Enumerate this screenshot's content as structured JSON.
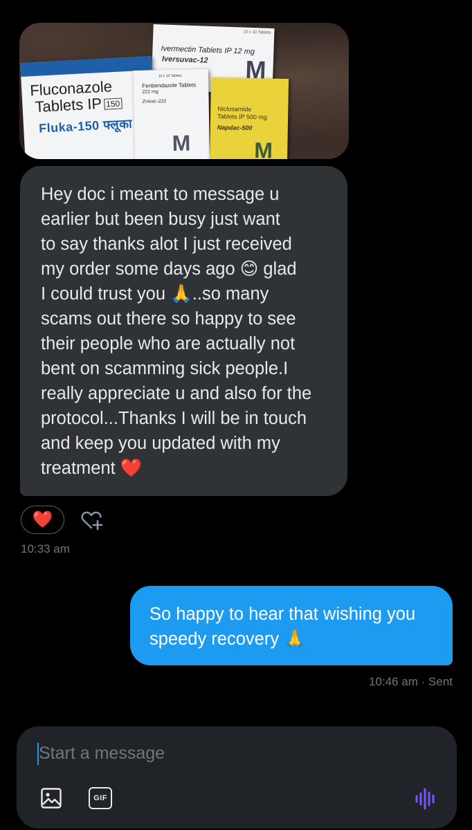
{
  "image_message": {
    "boxes": {
      "fluconazole": {
        "line1": "Fluconazole",
        "line2": "Tablets IP",
        "strength": "150",
        "brand": "Fluka-150 फ्लूका"
      },
      "ivermectin": {
        "top": "10 x 10 Tablets",
        "line1": "Ivermectin Tablets IP 12 mg",
        "brand": "Iversuvac-12",
        "mark": "M"
      },
      "fenbendazole": {
        "top": "10 x 10 Tablets",
        "line1": "Fenbendazole Tablets",
        "line2": "222 mg",
        "brand": "Zolvac-222",
        "mark": "M"
      },
      "niclosamide": {
        "line1": "Niclosamide",
        "line2": "Tablets IP 500 mg",
        "brand": "Napdac-500",
        "mark": "M"
      }
    }
  },
  "received_message": {
    "text": "Hey doc i meant to message u\nearlier but been busy just want\nto say thanks alot I just received\nmy order  some days ago 😊 glad\nI could trust you 🙏..so many\nscams out there so happy to see\ntheir people who are actually not\nbent on scamming sick people.I\nreally appreciate u and also for the\nprotocol...Thanks I will be in touch\nand keep you updated with my\ntreatment   ❤️",
    "reaction": "❤️",
    "time": "10:33 am"
  },
  "sent_message": {
    "text": "So happy to hear that wishing you\nspeedy recovery 🙏",
    "status": "10:46 am · Sent"
  },
  "composer": {
    "placeholder": "Start a message",
    "gif_label": "GIF",
    "icons": [
      "image-icon",
      "gif-icon",
      "voice-message-icon",
      "add-reaction-icon"
    ]
  },
  "colors": {
    "background": "#000000",
    "received_bubble": "#2f3336",
    "sent_bubble": "#1d9bf0",
    "muted_text": "#71767b",
    "voice_icon": "#7856ff"
  }
}
